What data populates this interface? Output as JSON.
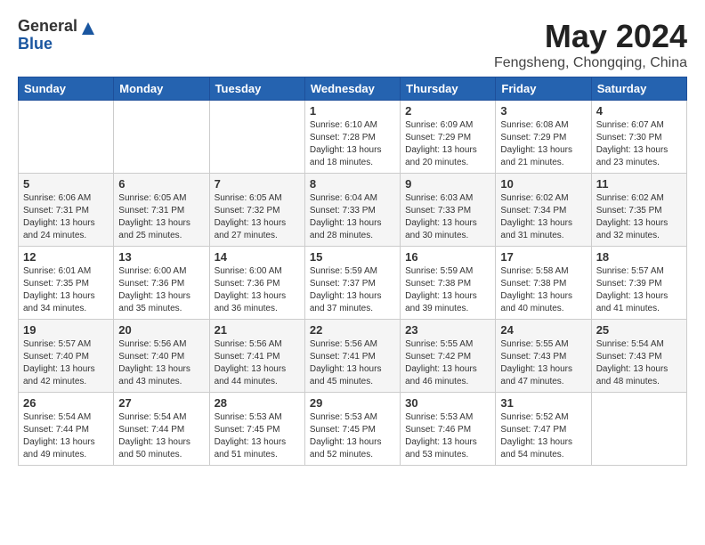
{
  "logo": {
    "general": "General",
    "blue": "Blue"
  },
  "header": {
    "month_year": "May 2024",
    "location": "Fengsheng, Chongqing, China"
  },
  "weekdays": [
    "Sunday",
    "Monday",
    "Tuesday",
    "Wednesday",
    "Thursday",
    "Friday",
    "Saturday"
  ],
  "weeks": [
    [
      {
        "day": "",
        "info": ""
      },
      {
        "day": "",
        "info": ""
      },
      {
        "day": "",
        "info": ""
      },
      {
        "day": "1",
        "info": "Sunrise: 6:10 AM\nSunset: 7:28 PM\nDaylight: 13 hours and 18 minutes."
      },
      {
        "day": "2",
        "info": "Sunrise: 6:09 AM\nSunset: 7:29 PM\nDaylight: 13 hours and 20 minutes."
      },
      {
        "day": "3",
        "info": "Sunrise: 6:08 AM\nSunset: 7:29 PM\nDaylight: 13 hours and 21 minutes."
      },
      {
        "day": "4",
        "info": "Sunrise: 6:07 AM\nSunset: 7:30 PM\nDaylight: 13 hours and 23 minutes."
      }
    ],
    [
      {
        "day": "5",
        "info": "Sunrise: 6:06 AM\nSunset: 7:31 PM\nDaylight: 13 hours and 24 minutes."
      },
      {
        "day": "6",
        "info": "Sunrise: 6:05 AM\nSunset: 7:31 PM\nDaylight: 13 hours and 25 minutes."
      },
      {
        "day": "7",
        "info": "Sunrise: 6:05 AM\nSunset: 7:32 PM\nDaylight: 13 hours and 27 minutes."
      },
      {
        "day": "8",
        "info": "Sunrise: 6:04 AM\nSunset: 7:33 PM\nDaylight: 13 hours and 28 minutes."
      },
      {
        "day": "9",
        "info": "Sunrise: 6:03 AM\nSunset: 7:33 PM\nDaylight: 13 hours and 30 minutes."
      },
      {
        "day": "10",
        "info": "Sunrise: 6:02 AM\nSunset: 7:34 PM\nDaylight: 13 hours and 31 minutes."
      },
      {
        "day": "11",
        "info": "Sunrise: 6:02 AM\nSunset: 7:35 PM\nDaylight: 13 hours and 32 minutes."
      }
    ],
    [
      {
        "day": "12",
        "info": "Sunrise: 6:01 AM\nSunset: 7:35 PM\nDaylight: 13 hours and 34 minutes."
      },
      {
        "day": "13",
        "info": "Sunrise: 6:00 AM\nSunset: 7:36 PM\nDaylight: 13 hours and 35 minutes."
      },
      {
        "day": "14",
        "info": "Sunrise: 6:00 AM\nSunset: 7:36 PM\nDaylight: 13 hours and 36 minutes."
      },
      {
        "day": "15",
        "info": "Sunrise: 5:59 AM\nSunset: 7:37 PM\nDaylight: 13 hours and 37 minutes."
      },
      {
        "day": "16",
        "info": "Sunrise: 5:59 AM\nSunset: 7:38 PM\nDaylight: 13 hours and 39 minutes."
      },
      {
        "day": "17",
        "info": "Sunrise: 5:58 AM\nSunset: 7:38 PM\nDaylight: 13 hours and 40 minutes."
      },
      {
        "day": "18",
        "info": "Sunrise: 5:57 AM\nSunset: 7:39 PM\nDaylight: 13 hours and 41 minutes."
      }
    ],
    [
      {
        "day": "19",
        "info": "Sunrise: 5:57 AM\nSunset: 7:40 PM\nDaylight: 13 hours and 42 minutes."
      },
      {
        "day": "20",
        "info": "Sunrise: 5:56 AM\nSunset: 7:40 PM\nDaylight: 13 hours and 43 minutes."
      },
      {
        "day": "21",
        "info": "Sunrise: 5:56 AM\nSunset: 7:41 PM\nDaylight: 13 hours and 44 minutes."
      },
      {
        "day": "22",
        "info": "Sunrise: 5:56 AM\nSunset: 7:41 PM\nDaylight: 13 hours and 45 minutes."
      },
      {
        "day": "23",
        "info": "Sunrise: 5:55 AM\nSunset: 7:42 PM\nDaylight: 13 hours and 46 minutes."
      },
      {
        "day": "24",
        "info": "Sunrise: 5:55 AM\nSunset: 7:43 PM\nDaylight: 13 hours and 47 minutes."
      },
      {
        "day": "25",
        "info": "Sunrise: 5:54 AM\nSunset: 7:43 PM\nDaylight: 13 hours and 48 minutes."
      }
    ],
    [
      {
        "day": "26",
        "info": "Sunrise: 5:54 AM\nSunset: 7:44 PM\nDaylight: 13 hours and 49 minutes."
      },
      {
        "day": "27",
        "info": "Sunrise: 5:54 AM\nSunset: 7:44 PM\nDaylight: 13 hours and 50 minutes."
      },
      {
        "day": "28",
        "info": "Sunrise: 5:53 AM\nSunset: 7:45 PM\nDaylight: 13 hours and 51 minutes."
      },
      {
        "day": "29",
        "info": "Sunrise: 5:53 AM\nSunset: 7:45 PM\nDaylight: 13 hours and 52 minutes."
      },
      {
        "day": "30",
        "info": "Sunrise: 5:53 AM\nSunset: 7:46 PM\nDaylight: 13 hours and 53 minutes."
      },
      {
        "day": "31",
        "info": "Sunrise: 5:52 AM\nSunset: 7:47 PM\nDaylight: 13 hours and 54 minutes."
      },
      {
        "day": "",
        "info": ""
      }
    ]
  ]
}
